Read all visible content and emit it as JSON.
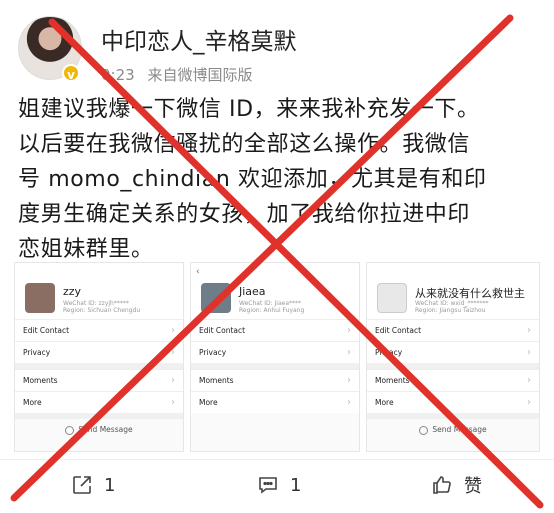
{
  "post": {
    "username": "中印恋人_辛格莫默",
    "time": "0:23",
    "source": "来自微博国际版",
    "lines": [
      "姐建议我爆一下微信 ID，来来我补充发一下。",
      "以后要在我微信骚扰的全部这么操作。我微信",
      "号 momo_chindian 欢迎添加，尤其是有和印",
      "度男生确定关系的女孩，加了我给你拉进中印",
      "恋姐妹群里。"
    ]
  },
  "screenshots": [
    {
      "nick": "zzy",
      "sub1": "WeChat ID: zzyjh*****",
      "sub2": "Region: Sichuan Chengdu",
      "rows": [
        "Edit Contact",
        "Privacy",
        "Moments",
        "More"
      ],
      "send": "Send Message"
    },
    {
      "back": "‹",
      "nick": "Jiaea",
      "sub1": "WeChat ID: Jiaea****",
      "sub2": "Region: Anhui Fuyang",
      "rows": [
        "Edit Contact",
        "Privacy",
        "Moments",
        "More"
      ]
    },
    {
      "nick": "从来就没有什么救世主",
      "sub1": "WeChat ID: wxid_*******",
      "sub2": "Region: Jiangsu Taizhou",
      "rows": [
        "Edit Contact",
        "Privacy",
        "Moments",
        "More"
      ],
      "send": "Send Message"
    }
  ],
  "actions": {
    "share_count": "1",
    "comment_count": "1",
    "like_label": "赞"
  },
  "colors": {
    "cross": "#e0322b",
    "verified": "#f2b705"
  }
}
